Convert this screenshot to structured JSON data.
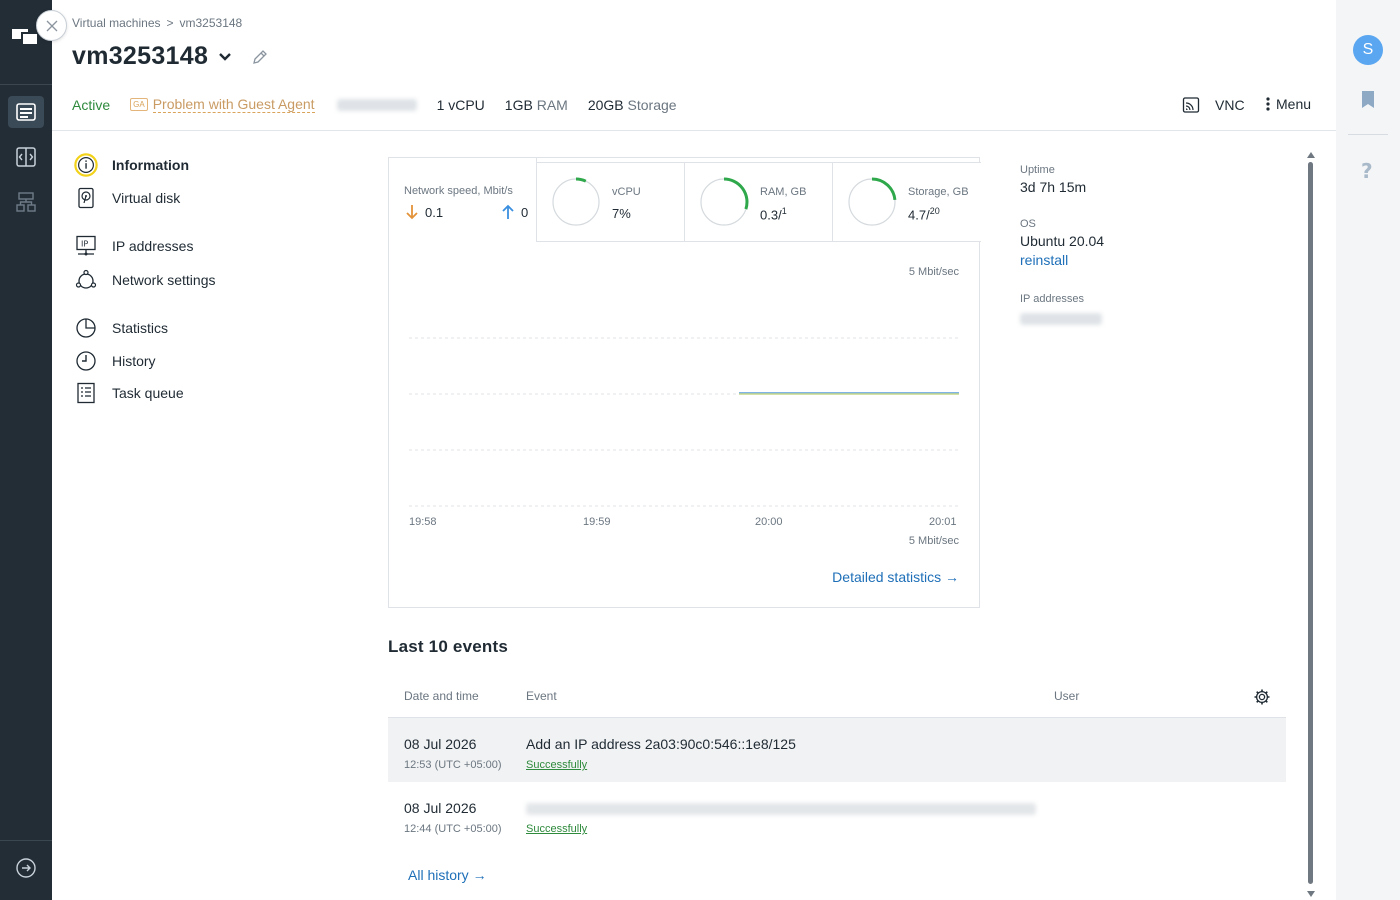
{
  "breadcrumb": {
    "parent": "Virtual machines",
    "separator": ">",
    "current": "vm3253148"
  },
  "header": {
    "title": "vm3253148"
  },
  "status": {
    "active": "Active",
    "ga_badge": "GA",
    "ga_problem": "Problem with Guest Agent",
    "vcpu": "1 vCPU",
    "ram_value": "1GB",
    "ram_label": "RAM",
    "storage_value": "20GB",
    "storage_label": "Storage"
  },
  "actions": {
    "vnc": "VNC",
    "menu": "Menu"
  },
  "user": {
    "avatar_letter": "S"
  },
  "sidemenu": {
    "information": "Information",
    "virtual_disk": "Virtual disk",
    "ip_addresses": "IP addresses",
    "network_settings": "Network settings",
    "statistics": "Statistics",
    "history": "History",
    "task_queue": "Task queue"
  },
  "stats": {
    "network": {
      "label": "Network speed, Mbit/s",
      "down": "0.1",
      "up": "0"
    },
    "vcpu": {
      "label": "vCPU",
      "value": "7%",
      "fraction": 0.07
    },
    "ram": {
      "label": "RAM, GB",
      "used": "0.3/",
      "total": "1",
      "fraction": 0.3
    },
    "storage": {
      "label": "Storage, GB",
      "used": "4.7/",
      "total": "20",
      "fraction": 0.235
    }
  },
  "chart": {
    "top_label": "5 Mbit/sec",
    "bottom_label": "5 Mbit/sec",
    "x_ticks": [
      "19:58",
      "19:59",
      "20:00",
      "20:01"
    ],
    "detailed_link": "Detailed statistics →"
  },
  "chart_data": {
    "type": "line",
    "x": [
      "19:58",
      "19:59",
      "20:00",
      "20:01"
    ],
    "series": [
      {
        "values": [
          null,
          null,
          0.1,
          0.1
        ]
      },
      {
        "values": [
          null,
          null,
          0,
          0
        ]
      }
    ],
    "xlabel": "",
    "ylabel": "5 Mbit/sec",
    "grid": true,
    "colors": [
      "#6fa9e3",
      "#c7d98a"
    ]
  },
  "info": {
    "uptime_label": "Uptime",
    "uptime": "3d 7h 15m",
    "os_label": "OS",
    "os": "Ubuntu 20.04",
    "reinstall": "reinstall",
    "ip_label": "IP addresses"
  },
  "events": {
    "title": "Last 10 events",
    "columns": {
      "date": "Date and time",
      "event": "Event",
      "user": "User"
    },
    "rows": [
      {
        "date": "08 Jul 2026",
        "time": "12:53 (UTC +05:00)",
        "event": "Add an IP address 2a03:90c0:546::1e8/125",
        "status": "Successfully"
      },
      {
        "date": "08 Jul 2026",
        "time": "12:44 (UTC +05:00)",
        "event": "",
        "status": "Successfully"
      }
    ],
    "all_history": "All history →"
  },
  "colors": {
    "nav_bg": "#232d36",
    "accent_blue": "#1e6fb8",
    "success_green": "#2e8a3c",
    "warning": "#d9a35a",
    "avatar": "#5aa6f0",
    "highlight_yellow": "#f2d21a"
  }
}
